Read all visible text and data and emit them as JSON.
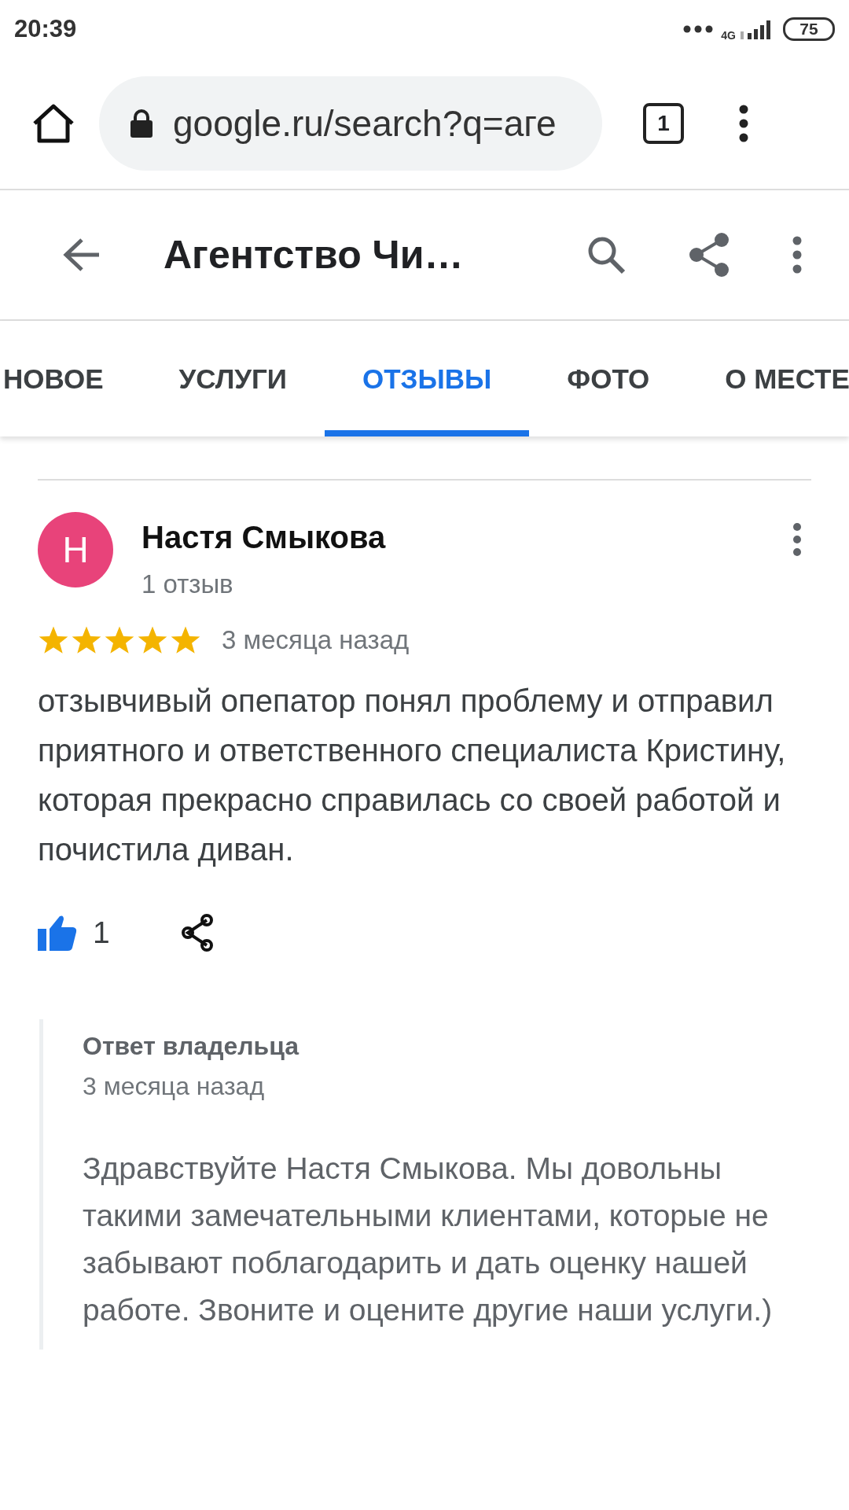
{
  "status_bar": {
    "time": "20:39",
    "network": "4G",
    "battery": "75"
  },
  "browser": {
    "url": "google.ru/search?q=аге",
    "tab_count": "1"
  },
  "header": {
    "title": "Агентство Чи…"
  },
  "tabs": [
    {
      "label": "НОВОЕ",
      "selected": false
    },
    {
      "label": "УСЛУГИ",
      "selected": false
    },
    {
      "label": "ОТЗЫВЫ",
      "selected": true
    },
    {
      "label": "ФОТО",
      "selected": false
    },
    {
      "label": "О МЕСТЕ",
      "selected": false
    }
  ],
  "review": {
    "avatar_letter": "Н",
    "color": "#e8437a",
    "author": "Настя Смыкова",
    "author_reviews": "1 отзыв",
    "stars": 5,
    "time": "3 месяца назад",
    "text": "отзывчивый опепатор понял проблему и отправил приятного и ответственного специалиста Кристину, которая прекрасно справилась со своей работой и почистила диван.",
    "likes": "1",
    "owner_reply": {
      "title": "Ответ владельца",
      "time": "3 месяца назад",
      "text": "Здравствуйте Настя Смыкова. Мы довольны такими замечательными клиентами, которые не забывают поблагодарить и дать оценку нашей работе. Звоните и оцените другие наши услуги.)"
    }
  }
}
